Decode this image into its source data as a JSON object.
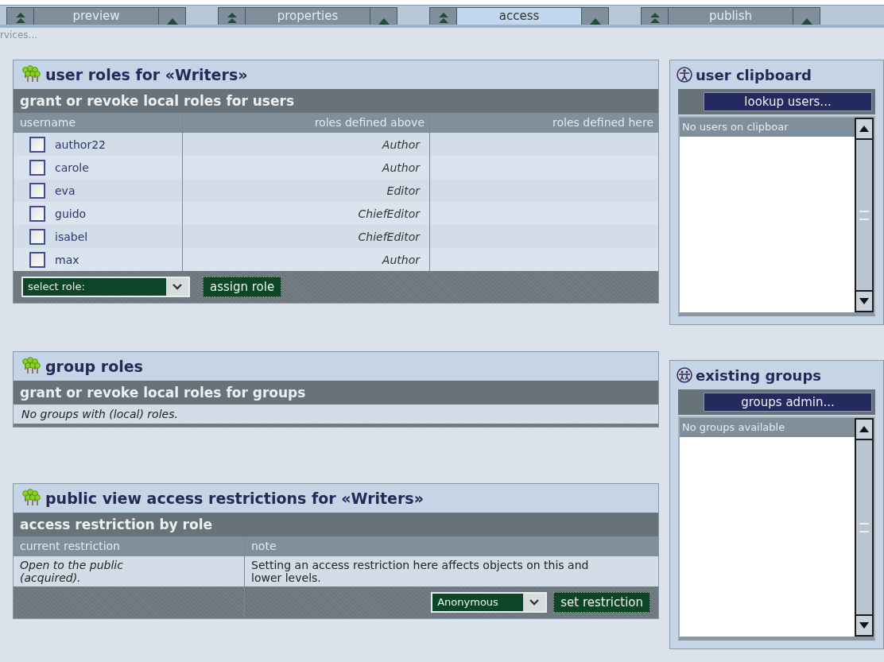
{
  "tabs": [
    {
      "label": "preview",
      "selected": false
    },
    {
      "label": "properties",
      "selected": false
    },
    {
      "label": "access",
      "selected": true
    },
    {
      "label": "publish",
      "selected": false
    }
  ],
  "breadcrumb": "rvices...",
  "user_roles": {
    "title": "user roles for «Writers»",
    "subtitle": "grant or revoke local roles for users",
    "columns": [
      "username",
      "roles defined above",
      "roles defined here"
    ],
    "rows": [
      {
        "username": "author22",
        "roles_above": "Author",
        "checked": false
      },
      {
        "username": "carole",
        "roles_above": "Author",
        "checked": false
      },
      {
        "username": "eva",
        "roles_above": "Editor",
        "checked": false
      },
      {
        "username": "guido",
        "roles_above": "ChiefEditor",
        "checked": false
      },
      {
        "username": "isabel",
        "roles_above": "ChiefEditor",
        "checked": false
      },
      {
        "username": "max",
        "roles_above": "Author",
        "checked": false
      }
    ],
    "role_select": "select role:",
    "assign_button": "assign role"
  },
  "group_roles": {
    "title": "group roles",
    "subtitle": "grant or revoke local roles for groups",
    "empty": "No groups with (local) roles."
  },
  "public_view": {
    "title": "public view access restrictions for «Writers»",
    "subtitle": "access restriction by role",
    "columns": [
      "current restriction",
      "note"
    ],
    "current": "Open to the public (acquired).",
    "note": "Setting an access restriction here affects objects on this and lower levels.",
    "restriction_select": "Anonymous",
    "set_button": "set restriction"
  },
  "user_clipboard": {
    "title": "user clipboard",
    "button": "lookup users...",
    "list_text": "No users on clipboar"
  },
  "existing_groups": {
    "title": "existing groups",
    "button": "groups admin...",
    "list_text": "No groups available"
  }
}
